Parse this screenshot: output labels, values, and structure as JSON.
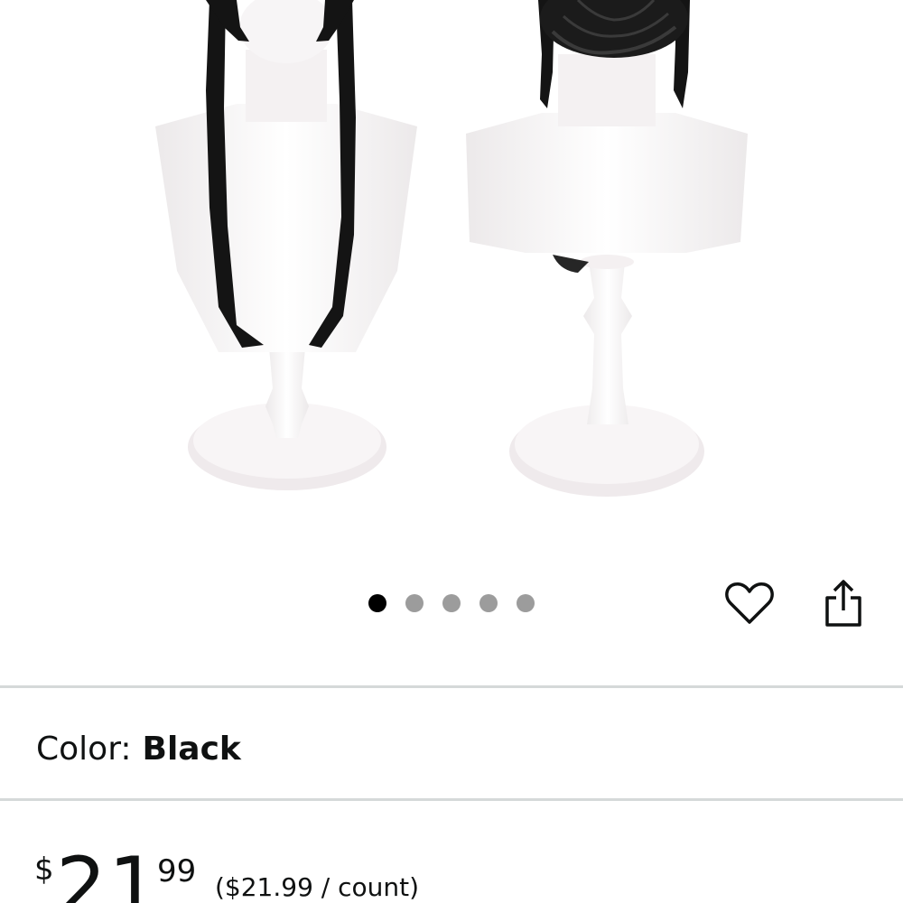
{
  "gallery": {
    "image_alt": "Long black wig with braided bun on mannequin display heads (front and back view)",
    "image_count": 5,
    "active_index": 0
  },
  "actions": {
    "favorite_icon": "heart-outline-icon",
    "share_icon": "share-icon"
  },
  "variation": {
    "label": "Color:",
    "value": "Black"
  },
  "price": {
    "currency_symbol": "$",
    "whole": "21",
    "fraction": "99",
    "unit_price": "($21.99 / count)"
  },
  "colors": {
    "text": "#0f1111",
    "divider": "#d5d9d9",
    "dot_active": "#000000",
    "dot_inactive": "#9c9c9c"
  }
}
